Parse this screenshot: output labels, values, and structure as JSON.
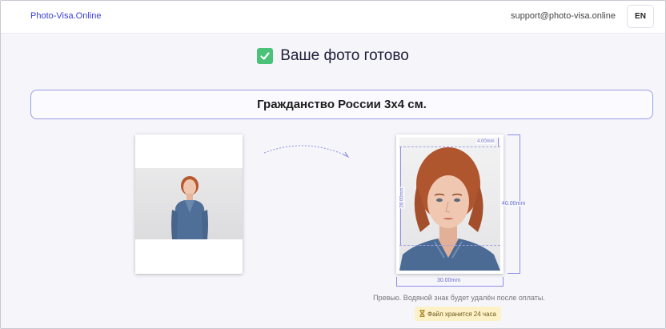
{
  "header": {
    "brand": "Photo-Visa.Online",
    "email": "support@photo-visa.online",
    "language": "EN"
  },
  "main": {
    "heading": "Ваше фото готово",
    "document_title": "Гражданство России 3x4 см.",
    "dimensions": {
      "width_label": "30.00mm",
      "height_label": "40.00mm",
      "top_margin_label": "4.00mm",
      "face_height_label": "28.00mm"
    },
    "preview_note": "Превью. Водяной знак будет удалён после оплаты.",
    "storage_badge": "Файл хранится 24 часа",
    "storage_icon": "hourglass-icon"
  },
  "colors": {
    "accent": "#3b3fd6",
    "success": "#4ac27a",
    "dimension": "#8c8fe6",
    "badge_bg": "#fdf1c8"
  }
}
